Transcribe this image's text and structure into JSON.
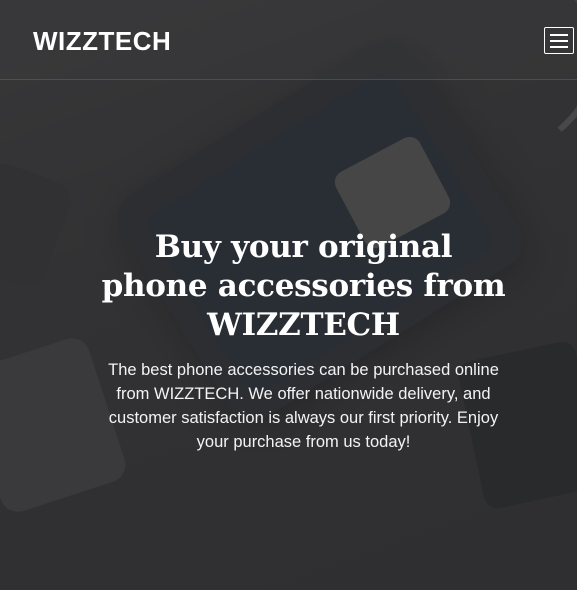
{
  "header": {
    "brand": "WIZZTECH",
    "menu_icon": "hamburger-menu-icon"
  },
  "hero": {
    "headline": "Buy your original phone accessories from WIZZTECH",
    "description": "The best phone accessories can be purchased online from WIZZTECH. We offer nationwide delivery, and customer satisfaction is always our first priority. Enjoy your purchase from us today!"
  },
  "colors": {
    "overlay": "#3b3b3c",
    "text": "#ffffff"
  }
}
